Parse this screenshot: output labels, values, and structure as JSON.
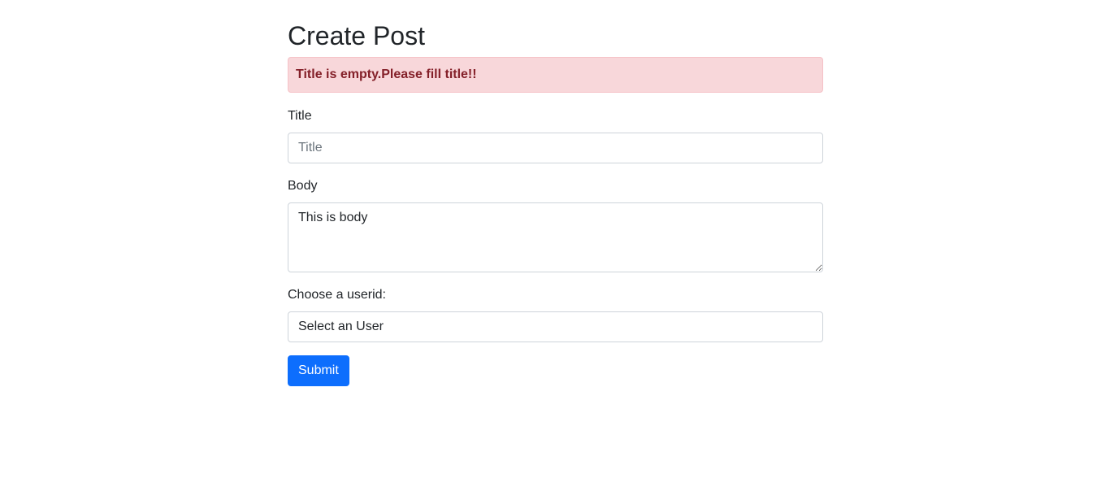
{
  "page": {
    "title": "Create Post"
  },
  "alert": {
    "message": "Title is empty.Please fill title!!"
  },
  "form": {
    "title_label": "Title",
    "title_placeholder": "Title",
    "title_value": "",
    "body_label": "Body",
    "body_value": "This is body",
    "userid_label": "Choose a userid:",
    "userid_selected": "Select an User",
    "submit_label": "Submit"
  },
  "colors": {
    "alert_bg": "#f8d7da",
    "alert_text": "#842029",
    "primary": "#0d6efd"
  }
}
